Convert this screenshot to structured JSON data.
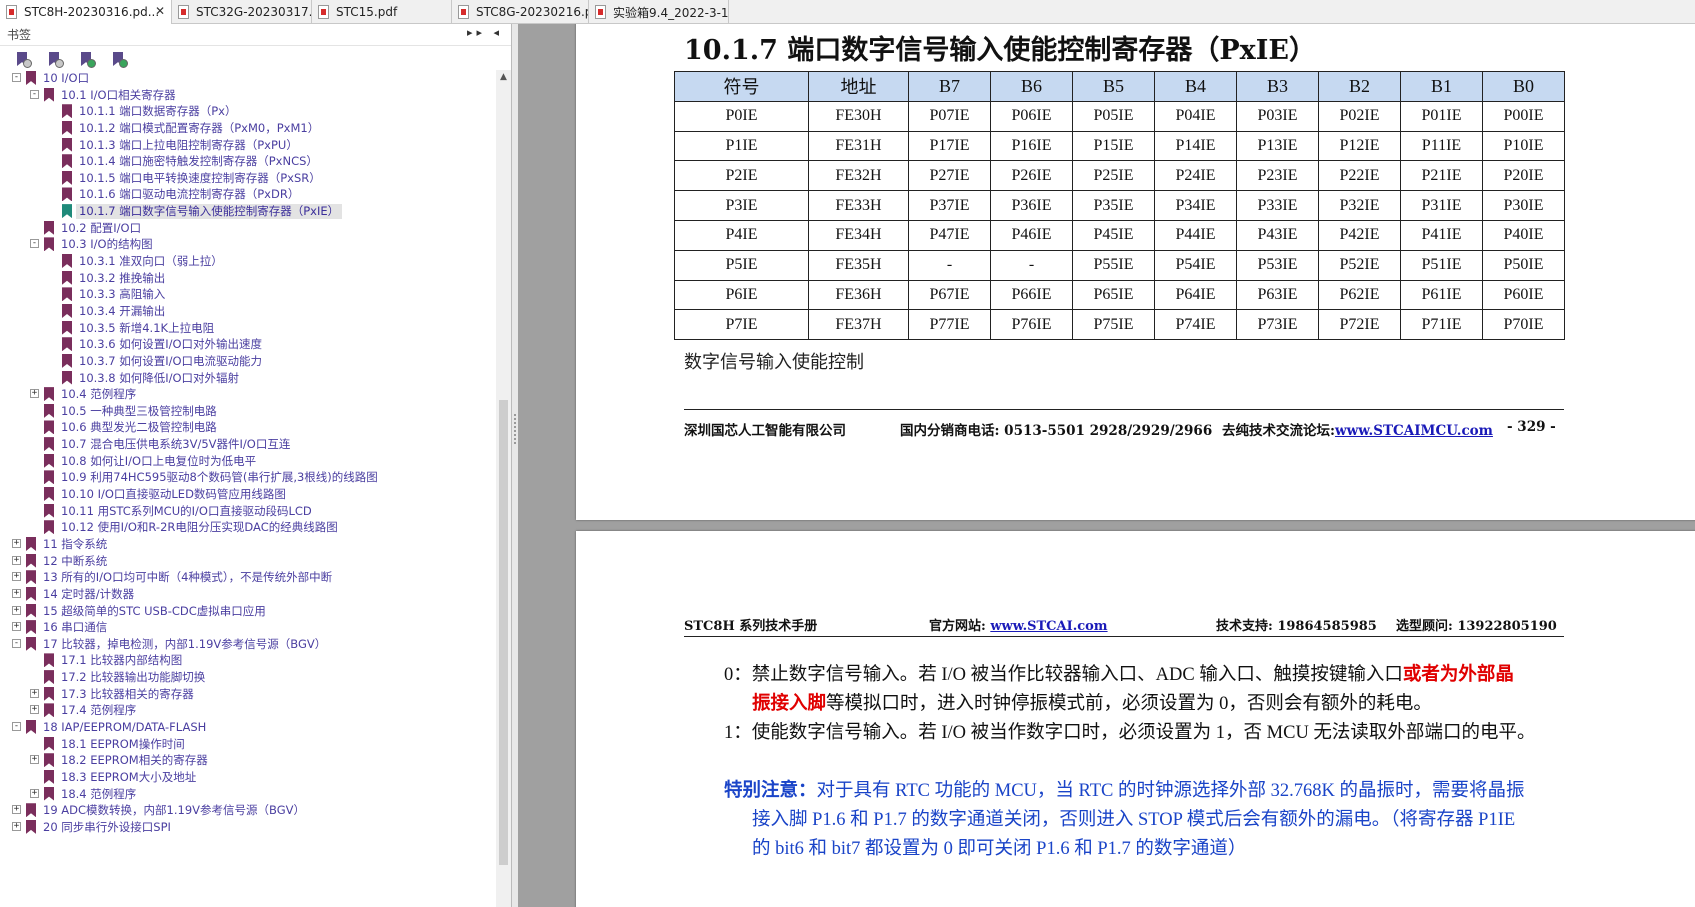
{
  "tabs": [
    {
      "label": "STC8H-20230316.pd...",
      "close": "✕"
    },
    {
      "label": "STC32G-20230317...."
    },
    {
      "label": "STC15.pdf"
    },
    {
      "label": "STC8G-20230216.p..."
    },
    {
      "label": "实验箱9.4_2022-3-1..."
    }
  ],
  "sidebar": {
    "title": "书签",
    "controls": "▸▸ ◂",
    "tree": [
      {
        "label": "10 I/O口"
      },
      {
        "label": "10.1 I/O口相关寄存器"
      },
      {
        "label": "10.1.1 端口数据寄存器（Px）"
      },
      {
        "label": "10.1.2 端口模式配置寄存器（PxM0，PxM1）"
      },
      {
        "label": "10.1.3 端口上拉电阻控制寄存器（PxPU）"
      },
      {
        "label": "10.1.4 端口施密特触发控制寄存器（PxNCS）"
      },
      {
        "label": "10.1.5 端口电平转换速度控制寄存器（PxSR）"
      },
      {
        "label": "10.1.6 端口驱动电流控制寄存器（PxDR）"
      },
      {
        "label": "10.1.7 端口数字信号输入使能控制寄存器（PxIE）"
      },
      {
        "label": "10.2 配置I/O口"
      },
      {
        "label": "10.3 I/O的结构图"
      },
      {
        "label": "10.3.1 准双向口（弱上拉）"
      },
      {
        "label": "10.3.2 推挽输出"
      },
      {
        "label": "10.3.3 高阻输入"
      },
      {
        "label": "10.3.4 开漏输出"
      },
      {
        "label": "10.3.5 新增4.1K上拉电阻"
      },
      {
        "label": "10.3.6 如何设置I/O口对外输出速度"
      },
      {
        "label": "10.3.7 如何设置I/O口电流驱动能力"
      },
      {
        "label": "10.3.8 如何降低I/O口对外辐射"
      },
      {
        "label": "10.4 范例程序"
      },
      {
        "label": "10.5 一种典型三极管控制电路"
      },
      {
        "label": "10.6 典型发光二极管控制电路"
      },
      {
        "label": "10.7 混合电压供电系统3V/5V器件I/O口互连"
      },
      {
        "label": "10.8 如何让I/O口上电复位时为低电平"
      },
      {
        "label": "10.9 利用74HC595驱动8个数码管(串行扩展,3根线)的线路图"
      },
      {
        "label": "10.10 I/O口直接驱动LED数码管应用线路图"
      },
      {
        "label": "10.11 用STC系列MCU的I/O口直接驱动段码LCD"
      },
      {
        "label": "10.12 使用I/O和R-2R电阻分压实现DAC的经典线路图"
      },
      {
        "label": "11 指令系统"
      },
      {
        "label": "12 中断系统"
      },
      {
        "label": "13 所有的I/O口均可中断（4种模式），不是传统外部中断"
      },
      {
        "label": "14 定时器/计数器"
      },
      {
        "label": "15 超级简单的STC USB-CDC虚拟串口应用"
      },
      {
        "label": "16 串口通信"
      },
      {
        "label": "17 比较器，掉电检测，内部1.19V参考信号源（BGV）"
      },
      {
        "label": "17.1 比较器内部结构图"
      },
      {
        "label": "17.2 比较器输出功能脚切换"
      },
      {
        "label": "17.3 比较器相关的寄存器"
      },
      {
        "label": "17.4 范例程序"
      },
      {
        "label": "18 IAP/EEPROM/DATA-FLASH"
      },
      {
        "label": "18.1 EEPROM操作时间"
      },
      {
        "label": "18.2 EEPROM相关的寄存器"
      },
      {
        "label": "18.3 EEPROM大小及地址"
      },
      {
        "label": "18.4 范例程序"
      },
      {
        "label": "19 ADC模数转换，内部1.19V参考信号源（BGV）"
      },
      {
        "label": "20 同步串行外设接口SPI"
      }
    ]
  },
  "page1": {
    "title": "10.1.7  端口数字信号输入使能控制寄存器（PxIE）",
    "headers": [
      "符号",
      "地址",
      "B7",
      "B6",
      "B5",
      "B4",
      "B3",
      "B2",
      "B1",
      "B0"
    ],
    "rows": [
      [
        "P0IE",
        "FE30H",
        "P07IE",
        "P06IE",
        "P05IE",
        "P04IE",
        "P03IE",
        "P02IE",
        "P01IE",
        "P00IE"
      ],
      [
        "P1IE",
        "FE31H",
        "P17IE",
        "P16IE",
        "P15IE",
        "P14IE",
        "P13IE",
        "P12IE",
        "P11IE",
        "P10IE"
      ],
      [
        "P2IE",
        "FE32H",
        "P27IE",
        "P26IE",
        "P25IE",
        "P24IE",
        "P23IE",
        "P22IE",
        "P21IE",
        "P20IE"
      ],
      [
        "P3IE",
        "FE33H",
        "P37IE",
        "P36IE",
        "P35IE",
        "P34IE",
        "P33IE",
        "P32IE",
        "P31IE",
        "P30IE"
      ],
      [
        "P4IE",
        "FE34H",
        "P47IE",
        "P46IE",
        "P45IE",
        "P44IE",
        "P43IE",
        "P42IE",
        "P41IE",
        "P40IE"
      ],
      [
        "P5IE",
        "FE35H",
        "-",
        "-",
        "P55IE",
        "P54IE",
        "P53IE",
        "P52IE",
        "P51IE",
        "P50IE"
      ],
      [
        "P6IE",
        "FE36H",
        "P67IE",
        "P66IE",
        "P65IE",
        "P64IE",
        "P63IE",
        "P62IE",
        "P61IE",
        "P60IE"
      ],
      [
        "P7IE",
        "FE37H",
        "P77IE",
        "P76IE",
        "P75IE",
        "P74IE",
        "P73IE",
        "P72IE",
        "P71IE",
        "P70IE"
      ]
    ],
    "caption": "数字信号输入使能控制",
    "footer": {
      "company": "深圳国芯人工智能有限公司",
      "phone": "国内分销商电话: 0513-5501 2928/2929/2966",
      "forum_label": "去纯技术交流论坛:",
      "forum_url": "www.STCAIMCU.com",
      "page": "- 329 -"
    }
  },
  "page2": {
    "header": {
      "manual": "STC8H 系列技术手册",
      "site_label": "官方网站: ",
      "site_url": "www.STCAI.com",
      "support": "技术支持: 19864585985",
      "consult": "选型顾问: 13922805190"
    },
    "p0_a": "0：禁止数字信号输入。若 I/O 被当作比较器输入口、ADC 输入口、触摸按键输入口",
    "p0_red1": "或者为外部晶",
    "p0_red2": "振接入脚",
    "p0_b": "等模拟口时，进入时钟停振模式前，必须设置为 0，否则会有额外的耗电。",
    "p1": "1：使能数字信号输入。若 I/O 被当作数字口时，必须设置为 1，否 MCU 无法读取外部端口的电平。",
    "note_label": "特别注意：",
    "note1": "对于具有 RTC 功能的 MCU，当 RTC 的时钟源选择外部 32.768K 的晶振时，需要将晶振",
    "note2": "接入脚 P1.6 和 P1.7 的数字通道关闭，否则进入 STOP 模式后会有额外的漏电。（将寄存器 P1IE",
    "note3": "的 bit6 和 bit7 都设置为 0 即可关闭 P1.6 和 P1.7 的数字通道）"
  }
}
